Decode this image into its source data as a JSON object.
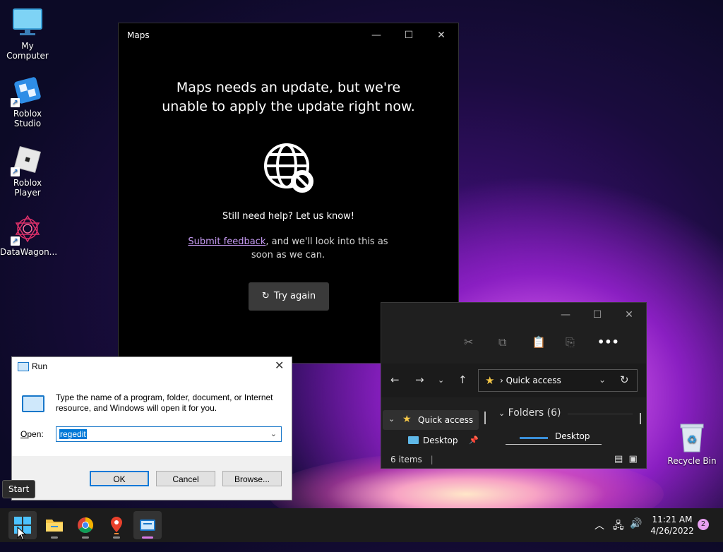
{
  "desktop": {
    "icons": [
      {
        "label": "My Computer"
      },
      {
        "label": "Roblox Studio"
      },
      {
        "label": "Roblox Player"
      },
      {
        "label": "DataWagon..."
      }
    ],
    "recycle_bin": "Recycle Bin"
  },
  "maps": {
    "title": "Maps",
    "heading_line1": "Maps needs an update, but we're",
    "heading_line2": "unable to apply the update right now.",
    "help": "Still need help? Let us know!",
    "feedback_link": "Submit feedback",
    "feedback_rest": ", and we'll look into this as soon as we can.",
    "try_again": "Try again"
  },
  "explorer": {
    "address": "Quick access",
    "nav_quick_access": "Quick access",
    "nav_desktop": "Desktop",
    "folders_heading": "Folders (6)",
    "folder_desktop": "Desktop",
    "status": "6 items"
  },
  "run": {
    "title": "Run",
    "description": "Type the name of a program, folder, document, or Internet resource, and Windows will open it for you.",
    "open_label": "Open:",
    "open_value": "regedit",
    "ok": "OK",
    "cancel": "Cancel",
    "browse": "Browse..."
  },
  "tooltip": "Start",
  "taskbar": {
    "time": "11:21 AM",
    "date": "4/26/2022",
    "notifications": "2"
  }
}
